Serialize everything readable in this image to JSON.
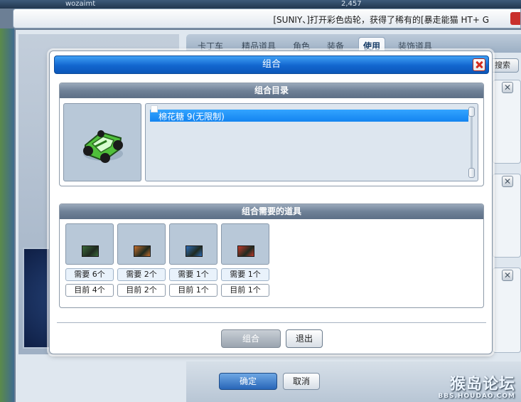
{
  "background": {
    "player_name": "wozaimt",
    "score": "2,457",
    "ticker_message": "[SUNIY、]打开彩色齿轮，获得了稀有的[暴走能猫 HT+ G",
    "tabs": [
      {
        "label": "卡丁车",
        "active": false
      },
      {
        "label": "精品道具",
        "active": false
      },
      {
        "label": "角色",
        "active": false
      },
      {
        "label": "装备",
        "active": false
      },
      {
        "label": "使用",
        "active": true
      },
      {
        "label": "装饰道具",
        "active": false
      }
    ],
    "search_label": "搜索",
    "confirm_label": "确定",
    "cancel_label": "取消",
    "watermark": {
      "main": "猴岛论坛",
      "sub": "BBS.HOUDAO.COM"
    }
  },
  "dialog": {
    "title": "组合",
    "catalog": {
      "header": "组合目录",
      "items": [
        {
          "label": "棉花糖 9(无限制)",
          "selected": true
        }
      ]
    },
    "required": {
      "header": "组合需要的道具",
      "items": [
        {
          "need": "需要 6个",
          "have": "目前 4个",
          "chip_color": "#3b6b3a"
        },
        {
          "need": "需要 2个",
          "have": "目前 2个",
          "chip_color": "#c7702e"
        },
        {
          "need": "需要 1个",
          "have": "目前 1个",
          "chip_color": "#2e6db8"
        },
        {
          "need": "需要 1个",
          "have": "目前 1个",
          "chip_color": "#c0392b"
        }
      ]
    },
    "buttons": {
      "combine": "组合",
      "exit": "退出"
    }
  }
}
